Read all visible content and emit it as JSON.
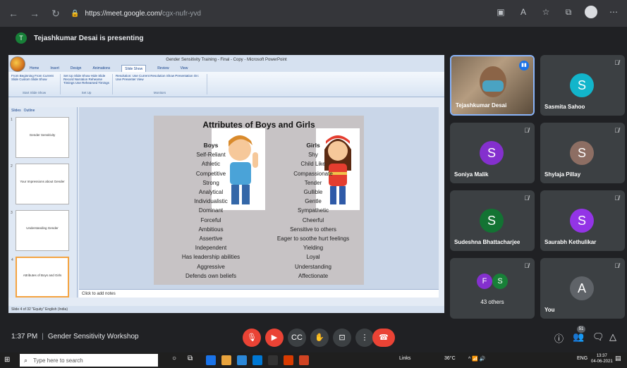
{
  "browser": {
    "url_host": "https://meet.google.com/",
    "url_path": "cgx-nufr-yvd"
  },
  "banner": {
    "avatar_letter": "T",
    "text": "Tejashkumar Desai is presenting"
  },
  "ppt": {
    "window_title": "Gender Sensitivity Training - Final - Copy - Microsoft PowerPoint",
    "tabs": [
      "Home",
      "Insert",
      "Design",
      "Animations",
      "Slide Show",
      "Review",
      "View"
    ],
    "active_tab": "Slide Show",
    "groups": [
      {
        "label": "Start Slide Show",
        "items": "From Beginning  From Current Slide  Custom Slide Show"
      },
      {
        "label": "Set Up",
        "items": "Set Up Slide Show  Hide Slide  Record Narration  Rehearse Timings  Use Rehearsed Timings"
      },
      {
        "label": "Monitors",
        "items": "Resolution: Use Current Resolution  Show Presentation On:  Use Presenter View"
      }
    ],
    "pane_tabs": [
      "Slides",
      "Outline"
    ],
    "thumbs": [
      "Gender Sensitivity",
      "Your Impressions about Gender",
      "Understanding Gender",
      "Attributes of Boys and Girls"
    ],
    "notes_placeholder": "Click to add notes",
    "status": "Slide 4 of 32   \"Equity\"   English (India)",
    "slide": {
      "title": "Attributes of Boys and Girls",
      "boys_heading": "Boys",
      "girls_heading": "Girls",
      "boys": [
        "Self-Reliant",
        "Athletic",
        "Competitive",
        "Strong",
        "Analytical",
        "Individualistic",
        "Dominant",
        "Forceful",
        "Ambitious",
        "Assertive",
        "Independent",
        "Has leadership abilities",
        "Aggressive",
        "Defends own beliefs"
      ],
      "girls": [
        "Shy",
        "Child Like",
        "Compassionate",
        "Tender",
        "Gullible",
        "Gentle",
        "Sympathetic",
        "Cheerful",
        "Sensitive to others",
        "Eager to soothe hurt feelings",
        "Yielding",
        "Loyal",
        "Understanding",
        "Affectionate"
      ]
    }
  },
  "participants": [
    {
      "name": "Tejashkumar Desai",
      "letter": "",
      "color": "",
      "video": true
    },
    {
      "name": "Sasmita Sahoo",
      "letter": "S",
      "color": "#12b5cb"
    },
    {
      "name": "Soniya Malik",
      "letter": "S",
      "color": "#8430ce"
    },
    {
      "name": "Shylaja Pillay",
      "letter": "S",
      "color": "#8d6e63"
    },
    {
      "name": "Sudeshna Bhattacharjee",
      "letter": "S",
      "color": "#137333"
    },
    {
      "name": "Saurabh Kethulikar",
      "letter": "S",
      "color": "#9334e6"
    },
    {
      "name": "43 others",
      "letter": "",
      "color": ""
    },
    {
      "name": "You",
      "letter": "A",
      "color": "#5f6368"
    }
  ],
  "others_avatars": [
    {
      "letter": "F",
      "color": "#8430ce"
    },
    {
      "letter": "S",
      "color": "#188038"
    }
  ],
  "controls": {
    "time": "1:37 PM",
    "meeting_name": "Gender Sensitivity Workshop",
    "people_count": "51"
  },
  "taskbar": {
    "search_placeholder": "Type here to search",
    "links_label": "Links",
    "temperature": "36°C",
    "language": "ENG",
    "clock_time": "13:37",
    "clock_date": "04-06-2021"
  }
}
